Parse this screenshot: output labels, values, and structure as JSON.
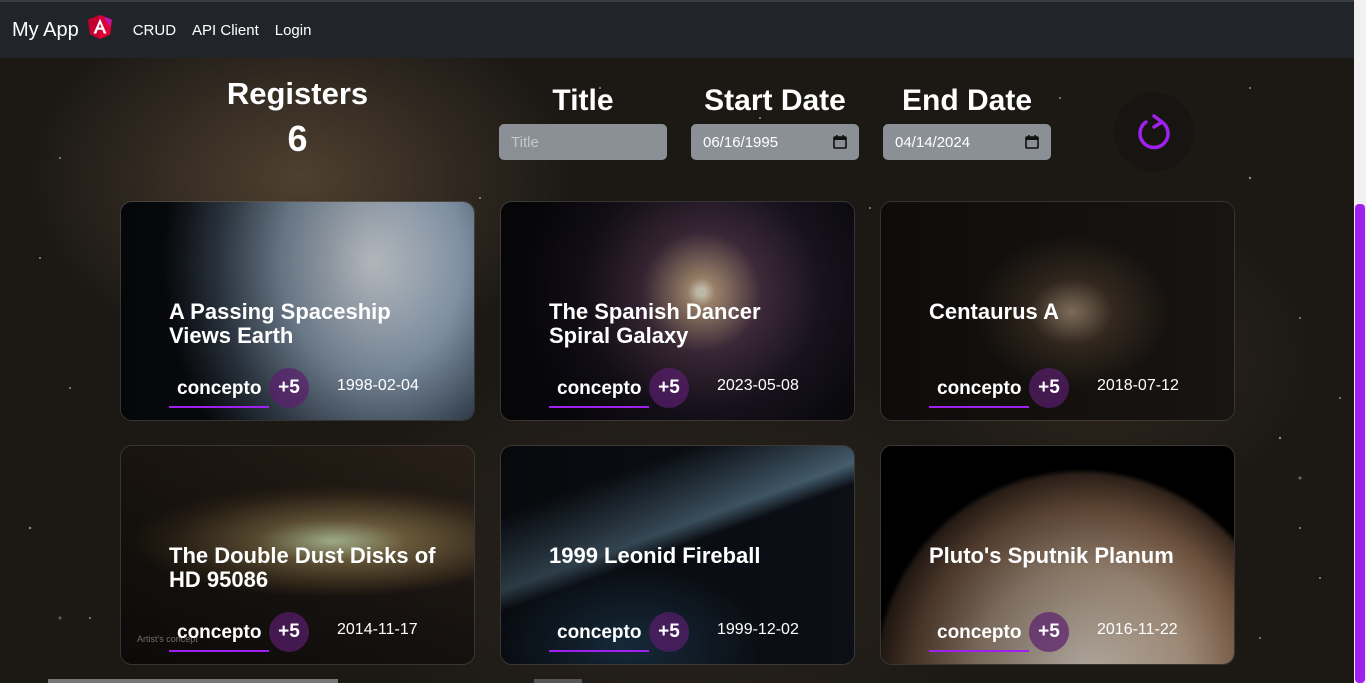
{
  "navbar": {
    "brand": "My App",
    "logo_icon": "angular-logo-icon",
    "links": [
      "CRUD",
      "API Client",
      "Login"
    ]
  },
  "registers": {
    "label": "Registers",
    "count": "6"
  },
  "filters": {
    "title": {
      "label": "Title",
      "placeholder": "Title",
      "value": ""
    },
    "start_date": {
      "label": "Start Date",
      "value": "06/16/1995"
    },
    "end_date": {
      "label": "End Date",
      "value": "04/14/2024"
    }
  },
  "refresh_icon": "refresh-icon",
  "accent_color": "#a020f0",
  "cards": [
    {
      "title": "A Passing Spaceship Views Earth",
      "tag": "concepto",
      "more": "+5",
      "date": "1998-02-04",
      "caption": ""
    },
    {
      "title": "The Spanish Dancer Spiral Galaxy",
      "tag": "concepto",
      "more": "+5",
      "date": "2023-05-08",
      "caption": ""
    },
    {
      "title": "Centaurus A",
      "tag": "concepto",
      "more": "+5",
      "date": "2018-07-12",
      "caption": ""
    },
    {
      "title": "The Double Dust Disks of HD 95086",
      "tag": "concepto",
      "more": "+5",
      "date": "2014-11-17",
      "caption": "Artist's concept"
    },
    {
      "title": "1999 Leonid Fireball",
      "tag": "concepto",
      "more": "+5",
      "date": "1999-12-02",
      "caption": ""
    },
    {
      "title": "Pluto's Sputnik Planum",
      "tag": "concepto",
      "more": "+5",
      "date": "2016-11-22",
      "caption": ""
    }
  ]
}
